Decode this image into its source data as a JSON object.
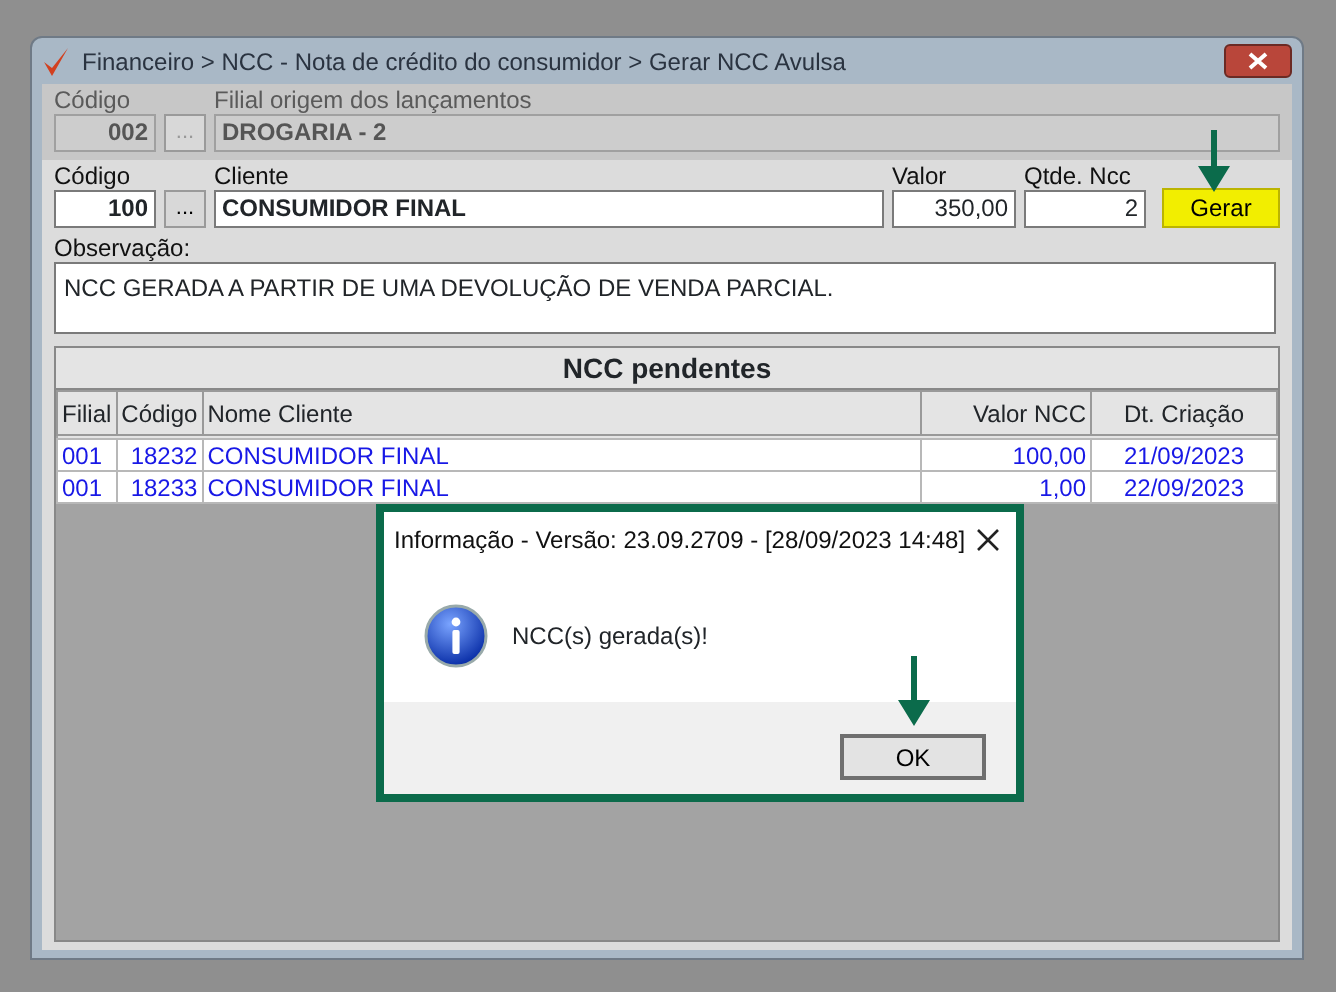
{
  "window": {
    "title": "Financeiro > NCC - Nota de crédito do consumidor > Gerar NCC Avulsa"
  },
  "filial": {
    "code_label": "Código",
    "code": "002",
    "lookup": "...",
    "name_label": "Filial origem dos lançamentos",
    "name": "DROGARIA - 2",
    "disabled": true
  },
  "cliente": {
    "code_label": "Código",
    "code": "100",
    "lookup": "...",
    "name_label": "Cliente",
    "name": "CONSUMIDOR FINAL",
    "valor_label": "Valor",
    "valor": "350,00",
    "qtde_label": "Qtde. Ncc",
    "qtde": "2",
    "button": "Gerar"
  },
  "observacao": {
    "label": "Observação:",
    "value": "NCC GERADA A PARTIR DE UMA DEVOLUÇÃO DE VENDA PARCIAL."
  },
  "table": {
    "title": "NCC pendentes",
    "columns": [
      "Filial",
      "Código",
      "Nome Cliente",
      "Valor NCC",
      "Dt. Criação"
    ],
    "rows": [
      [
        "001",
        "18232",
        "CONSUMIDOR FINAL",
        "100,00",
        "21/09/2023"
      ],
      [
        "001",
        "18233",
        "CONSUMIDOR FINAL",
        "1,00",
        "22/09/2023"
      ]
    ]
  },
  "dialog": {
    "title": "Informação - Versão: 23.09.2709 - [28/09/2023 14:48]",
    "message": "NCC(s) gerada(s)!",
    "button": "OK"
  }
}
